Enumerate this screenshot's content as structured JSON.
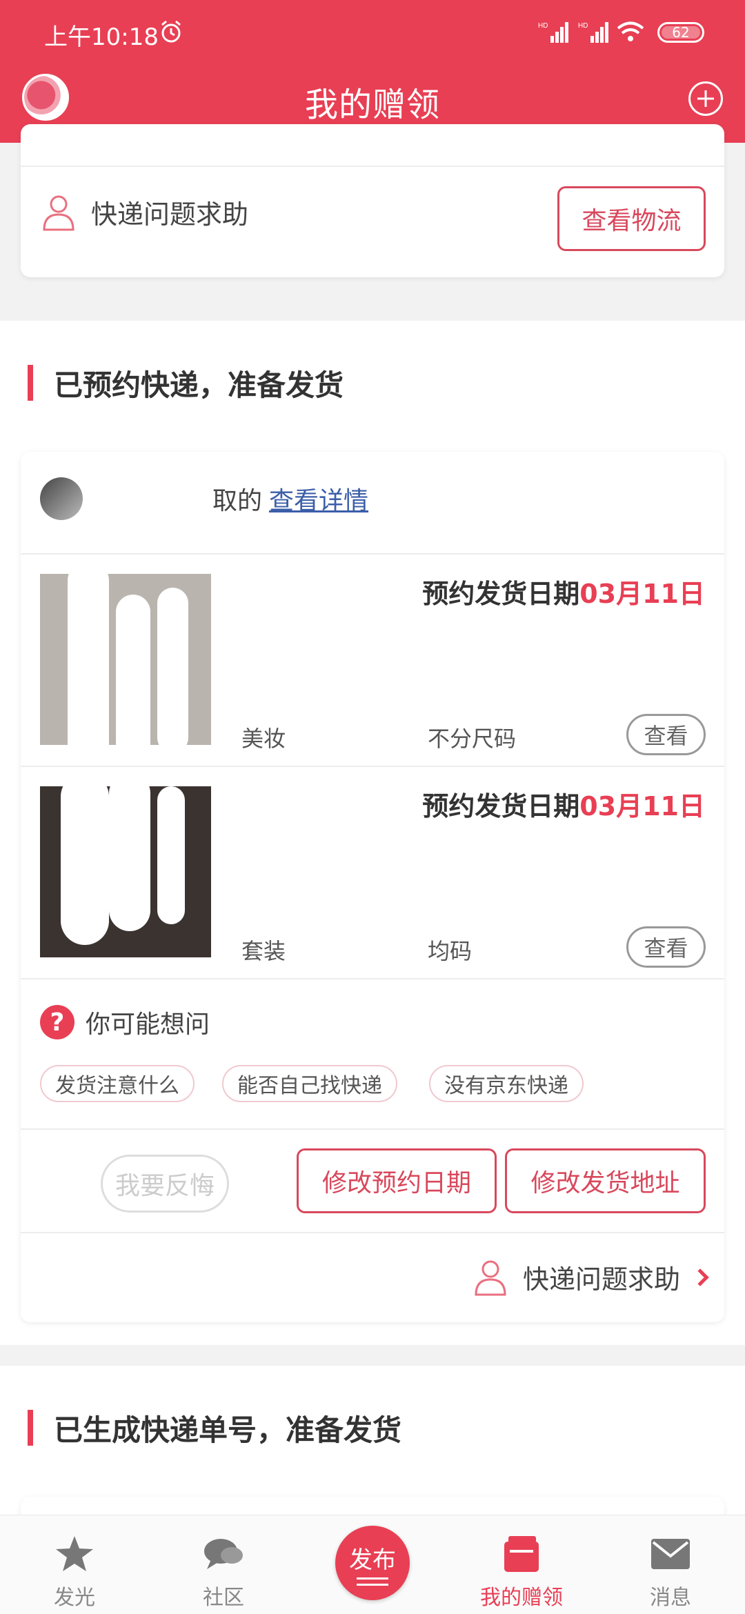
{
  "status_bar": {
    "time": "上午10:18",
    "battery": "62"
  },
  "header": {
    "title": "我的赠领"
  },
  "top_card": {
    "help_text": "快递问题求助",
    "button": "查看物流"
  },
  "section1": {
    "title": "已预约快递，准备发货",
    "giver_text": "取的",
    "detail_link": "查看详情",
    "items": [
      {
        "date_label": "预约发货日期",
        "date_value": "03月11日",
        "category": "美妆",
        "size": "不分尺码",
        "view": "查看"
      },
      {
        "date_label": "预约发货日期",
        "date_value": "03月11日",
        "category": "套装",
        "size": "均码",
        "view": "查看"
      }
    ],
    "faq_title": "你可能想问",
    "faq_q_mark": "?",
    "chips": [
      "发货注意什么",
      "能否自己找快递",
      "没有京东快递"
    ],
    "regret_btn": "我要反悔",
    "change_date_btn": "修改预约日期",
    "change_addr_btn": "修改发货地址",
    "help_text": "快递问题求助"
  },
  "section2": {
    "title": "已生成快递单号，准备发货"
  },
  "nav": {
    "items": [
      "发光",
      "社区",
      "我的赠领",
      "消息"
    ],
    "publish": "发布"
  },
  "colors": {
    "brand": "#e83f54"
  }
}
